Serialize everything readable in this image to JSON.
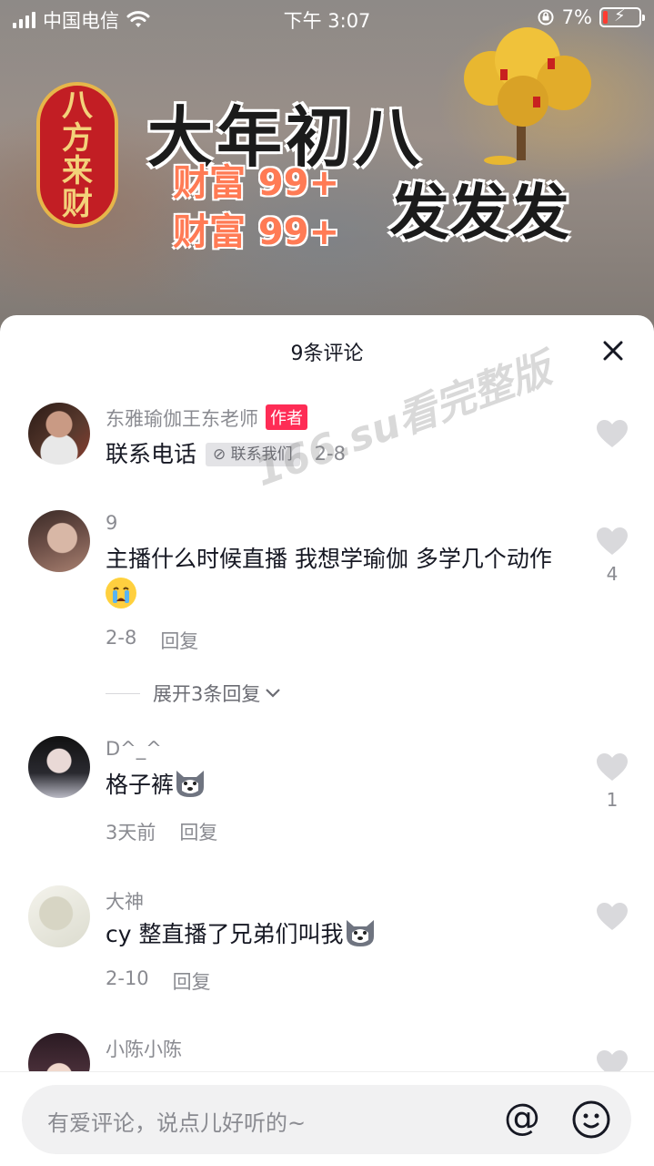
{
  "status_bar": {
    "carrier": "中国电信",
    "time": "下午 3:07",
    "battery": "7%"
  },
  "video": {
    "seal_text": [
      "八",
      "方",
      "来",
      "财"
    ],
    "title": "大年初八",
    "wealth_lines": [
      "财富 99+",
      "财富 99+"
    ],
    "fafafa": "发发发"
  },
  "sheet": {
    "title": "9条评论",
    "watermark": "166.su看完整版",
    "expand_label": "展开3条回复"
  },
  "comments": [
    {
      "name": "东雅瑜伽王东老师",
      "author_tag": "作者",
      "text": "联系电话",
      "contact_chip": "联系我们",
      "time": "2-8",
      "likes": ""
    },
    {
      "name": "9",
      "text": "主播什么时候直播 我想学瑜伽 多学几个动作",
      "emoji": "loudly-crying-face",
      "time": "2-8",
      "reply": "回复",
      "likes": "4"
    },
    {
      "name": "D^_^",
      "text": "格子裤",
      "emoji": "husky-dog-face",
      "time": "3天前",
      "reply": "回复",
      "likes": "1"
    },
    {
      "name": "大神",
      "text": "cy 整直播了兄弟们叫我",
      "emoji": "husky-dog-face",
      "time": "2-10",
      "reply": "回复",
      "likes": ""
    },
    {
      "name": "小陈小陈",
      "text": "",
      "likes": ""
    }
  ],
  "input": {
    "placeholder": "有爱评论，说点儿好听的~",
    "at_symbol": "@"
  },
  "colors": {
    "accent_red": "#fe2c55",
    "text_primary": "#161823",
    "text_secondary": "#8a8b91",
    "heart": "#d9d9dc"
  }
}
